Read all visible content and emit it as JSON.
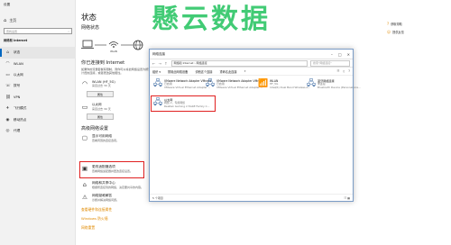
{
  "watermark": "懸云数据",
  "sidebar": {
    "app_title": "设置",
    "home": "主页",
    "search_placeholder": "查找设置",
    "section": "网络和 Internet",
    "items": [
      {
        "icon": "home-icon",
        "label": "状态",
        "active": true
      },
      {
        "icon": "wifi-icon",
        "label": "WLAN"
      },
      {
        "icon": "ethernet-icon",
        "label": "以太网"
      },
      {
        "icon": "phone-icon",
        "label": "拨号"
      },
      {
        "icon": "vpn-icon",
        "label": "VPN"
      },
      {
        "icon": "airplane-icon",
        "label": "飞行模式"
      },
      {
        "icon": "hotspot-icon",
        "label": "移动热点"
      },
      {
        "icon": "proxy-icon",
        "label": "代理"
      }
    ]
  },
  "status": {
    "title": "状态",
    "network_status": "网络状态",
    "wifi_label": "WLAN",
    "connected_title": "你已连接到 Internet",
    "connected_desc": "如果你的流量套餐有限制，则你可以将此网络设置为按流量计费的连接，或者更改其他属性。",
    "networks": [
      {
        "icon": "wifi-icon",
        "name": "WLAN (HF_5G)",
        "sub": "来自过去 30 天"
      },
      {
        "icon": "ethernet-icon",
        "name": "以太网",
        "sub": "来自过去 30 天"
      }
    ],
    "properties_label": "属性",
    "more_settings_title": "高级网络设置",
    "settings": [
      {
        "icon": "monitor-icon",
        "title": "显示可用网络",
        "desc": "查看周围的连接选项。"
      },
      {
        "icon": "adapter-icon",
        "title": "更改适配器选项",
        "desc": "查看网络适配器并更改连接设置。"
      },
      {
        "icon": "share-icon",
        "title": "网络和共享中心",
        "desc": "根据所连接到的网络，决定要共享的内容。"
      },
      {
        "icon": "warning-icon",
        "title": "网络疑难解答",
        "desc": "诊断并解决网络问题。"
      }
    ],
    "links": [
      "查看硬件和连接属性",
      "Windows 防火墙",
      "网络重置"
    ]
  },
  "window": {
    "title": "网络连接",
    "path": "网络和 Internet › 网络连接",
    "search_placeholder": "搜索\"网络连接\"",
    "commands": [
      "组织 ▾",
      "禁用此网络设备",
      "诊断这个连接",
      "重命名此连接",
      "»"
    ],
    "adapters": [
      {
        "name": "VMware Network Adapter VMnet1",
        "sub": "已启用"
      },
      {
        "name": "VMware Network Adapter VMnet8",
        "sub": "已启用"
      },
      {
        "name": "WLAN",
        "sub": "HF_5G"
      },
      {
        "name": "蓝牙网络连接",
        "sub": "未连接"
      },
      {
        "name": "以太网",
        "sub": "网络 2，专用网络"
      }
    ],
    "adapter_details": [
      "VMware Virtual Ethernet Adapter ...",
      "VMware Virtual Ethernet Adapter ...",
      "Intel(R) Dual Band Wireless-A...",
      "Bluetooth Device (Personal Are...",
      "Realtek Gaming 2.5GbE Family C..."
    ],
    "status_bar": "5 个项目"
  },
  "right_links": [
    {
      "icon": "help-icon",
      "label": "获取帮助"
    },
    {
      "icon": "feedback-icon",
      "label": "提供反馈"
    }
  ],
  "colors": {
    "accent": "#0067c0",
    "highlight_box": "#e02020",
    "link": "#e08a00",
    "watermark": "#22c35e"
  }
}
